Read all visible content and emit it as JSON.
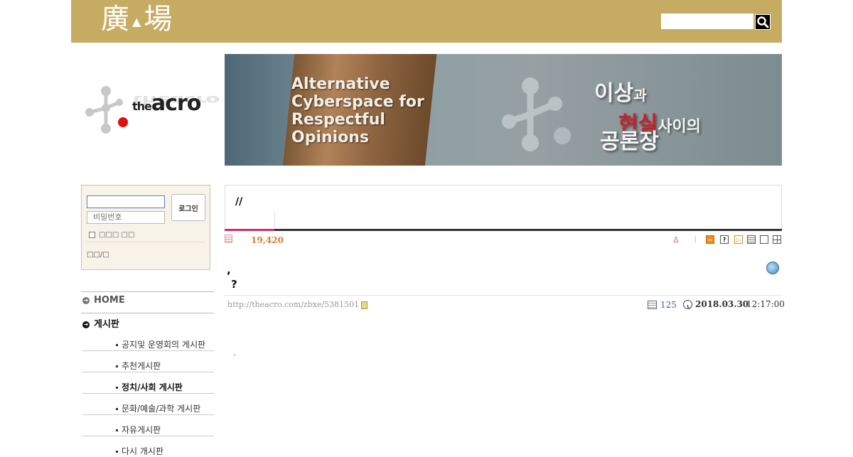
{
  "header": {
    "logo_hanja_1": "廣",
    "logo_hanja_2": "場",
    "logo_hanja_dot": "▲",
    "bg_color": "#c6ab63",
    "search_placeholder": "",
    "search_icon": "search-icon"
  },
  "site_logo": {
    "the": "the",
    "name": "acro"
  },
  "banner": {
    "en_lines": [
      "Alternative",
      "Cyberspace for",
      "Respectful",
      "Opinions"
    ],
    "ko_line1_a": "이상",
    "ko_line1_b": "과",
    "ko_line1_red": "현실",
    "ko_line1_c": "사이의",
    "ko_line2": "공론장"
  },
  "login": {
    "id_value": "",
    "password_placeholder": "비밀번호",
    "button_label": "로그인",
    "remember_label": "□□□ □□",
    "signup_label": "□□/□"
  },
  "nav": {
    "home": "HOME",
    "board": "게시판",
    "sub_items": [
      "공지및 운영회의 게시판",
      "추천게시판",
      "정치/사회 게시판",
      "문화/예술/과학 게시판",
      "자유게시판",
      "다시 개시판"
    ],
    "active_index": 2
  },
  "board": {
    "title": "//",
    "view_count": "19,420",
    "accent_color": "#c8326b"
  },
  "post": {
    "title_line1": ",",
    "title_line2": "?",
    "url": "http://theacro.com/zbxe/5381501",
    "read_count": "125",
    "date": "2018.03.30",
    "time": "12:17:00",
    "body": "."
  }
}
